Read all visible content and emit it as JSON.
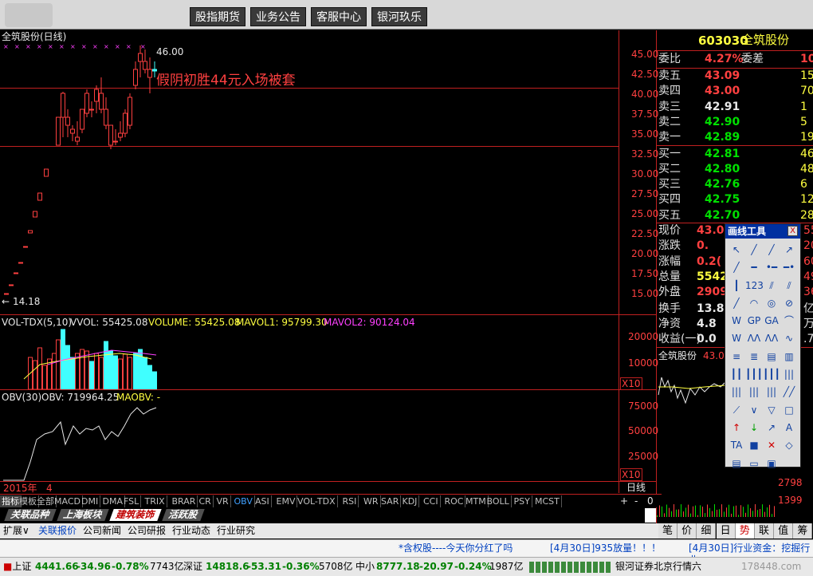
{
  "header": {
    "buttons": [
      "股指期货",
      "业务公告",
      "客服中心",
      "银河玖乐"
    ]
  },
  "chart": {
    "title": "全筑股份(日线)",
    "annotation": "假阴初胜44元入场被套",
    "high_label": "46.00",
    "low_label": "14.18",
    "y_ticks": [
      "45.00",
      "42.50",
      "40.00",
      "37.50",
      "35.00",
      "32.50",
      "30.00",
      "27.50",
      "25.00",
      "22.50",
      "20.00",
      "17.50",
      "15.00"
    ],
    "vol_legend": {
      "name": "VOL-TDX(5,10)",
      "vvol": "VVOL: 55425.08",
      "volume": "VOLUME: 55425.08",
      "mavol1": "MAVOL1: 95799.30",
      "mavol2": "MAVOL2: 90124.04"
    },
    "vol_ticks": [
      "20000",
      "10000"
    ],
    "vol_unit": "X10",
    "obv_legend": {
      "name": "OBV(30)",
      "obv": "OBV: 719964.25",
      "maobv": "MAOBV: -"
    },
    "obv_ticks": [
      "75000",
      "50000",
      "25000"
    ],
    "obv_unit": "X10",
    "date_year": "2015年",
    "date_month": "4",
    "period_label": "日线"
  },
  "indicator_tabs": [
    "指标",
    "模板",
    "全部",
    "MACD",
    "DMI",
    "DMA",
    "FSL",
    "TRIX",
    "BRAR",
    "CR",
    "VR",
    "OBV",
    "ASI",
    "EMV",
    "VOL-TDX",
    "RSI",
    "WR",
    "SAR",
    "KDJ",
    "CCI",
    "ROC",
    "MTM",
    "BOLL",
    "PSY",
    "MCST"
  ],
  "indicator_nav": [
    "+",
    "-",
    "0"
  ],
  "blocks": [
    "关联品种",
    "上海板块",
    "建筑装饰",
    "活跃股"
  ],
  "bottom_links": [
    "扩展∨",
    "关联报价",
    "公司新闻",
    "公司研报",
    "行业动态",
    "行业研究"
  ],
  "right_tabs": [
    "笔",
    "价",
    "细",
    "日",
    "势",
    "联",
    "值",
    "筹"
  ],
  "quote": {
    "code": "603030",
    "name": "全筑股份",
    "wei_bi_label": "委比",
    "wei_bi": "4.27%",
    "wei_cha_label": "委差",
    "wei_cha": "10",
    "asks": [
      {
        "label": "卖五",
        "price": "43.09",
        "vol": "15"
      },
      {
        "label": "卖四",
        "price": "43.00",
        "vol": "70"
      },
      {
        "label": "卖三",
        "price": "42.91",
        "vol": "1"
      },
      {
        "label": "卖二",
        "price": "42.90",
        "vol": "5"
      },
      {
        "label": "卖一",
        "price": "42.89",
        "vol": "19"
      }
    ],
    "bids": [
      {
        "label": "买一",
        "price": "42.81",
        "vol": "46"
      },
      {
        "label": "买二",
        "price": "42.80",
        "vol": "48"
      },
      {
        "label": "买三",
        "price": "42.76",
        "vol": "6"
      },
      {
        "label": "买四",
        "price": "42.75",
        "vol": "12"
      },
      {
        "label": "买五",
        "price": "42.70",
        "vol": "28"
      }
    ],
    "stats": [
      {
        "label": "现价",
        "value": "43.0"
      },
      {
        "label": "涨跌",
        "value": "0."
      },
      {
        "label": "涨幅",
        "value": "0.2("
      },
      {
        "label": "总量",
        "value": "5542"
      },
      {
        "label": "外盘",
        "value": "2909"
      },
      {
        "label": "换手",
        "value": "13.8("
      },
      {
        "label": "净资",
        "value": "4.8"
      },
      {
        "label": "收益(一)",
        "value": "0.0"
      }
    ],
    "stats_right": [
      "55",
      "20",
      "60",
      "49",
      "36",
      "亿",
      "万",
      ".7"
    ],
    "mini_title": "全筑股份",
    "mini_price": "43.0",
    "mini_unit": "X10",
    "mini_ticks": [
      "2798",
      "1399"
    ]
  },
  "tool_panel": {
    "title": "画线工具",
    "close": "X",
    "items": [
      "↖",
      "╱",
      "╱",
      "↗",
      "╱",
      "━",
      "•━",
      "━•",
      "┃",
      "123",
      "⫽",
      "⫽",
      "╱",
      "◠",
      "◎",
      "⊘",
      "W",
      "GP",
      "GA",
      "⌒",
      "W",
      "ΛΛ",
      "ΛΛ",
      "∿",
      "≡",
      "≣",
      "▤",
      "▥",
      "┃┃",
      "┃┃┃",
      "┃┃┃",
      "|||",
      "|||",
      "|||",
      "|||",
      "╱╱",
      "⟋",
      "∨",
      "▽",
      "□",
      "↑",
      "↓",
      "↗",
      "A",
      "TA",
      "■",
      "✕",
      "◇",
      "▤",
      "▭",
      "▣",
      ""
    ]
  },
  "bottom_ticker": {
    "scroll_1": "*含权股----今天你分红了吗",
    "scroll_2": "[4月30日]935放量！！！",
    "scroll_3": "[4月30日]行业资金：挖掘行业",
    "sh_label": "上证",
    "sh_value": "4441.66",
    "sh_change": "-34.96",
    "sh_pct": "-0.78%",
    "sh_amount": "7743亿",
    "sz_label": "深证",
    "sz_value": "14818.6",
    "sz_change": "-53.31",
    "sz_pct": "-0.36%",
    "sz_amount": "5708亿",
    "zx_label": "中小",
    "zx_value": "8777.18",
    "zx_change": "-20.97",
    "zx_pct": "-0.24%",
    "zx_amount": "1987亿",
    "broker": "银河证券北京行情六",
    "watermark": "178448.com"
  },
  "colors": {
    "up": "#ff4040",
    "down": "#40ffff",
    "grid": "#c02020",
    "vol_ma1": "#ffff40",
    "vol_ma2": "#ff40ff"
  }
}
